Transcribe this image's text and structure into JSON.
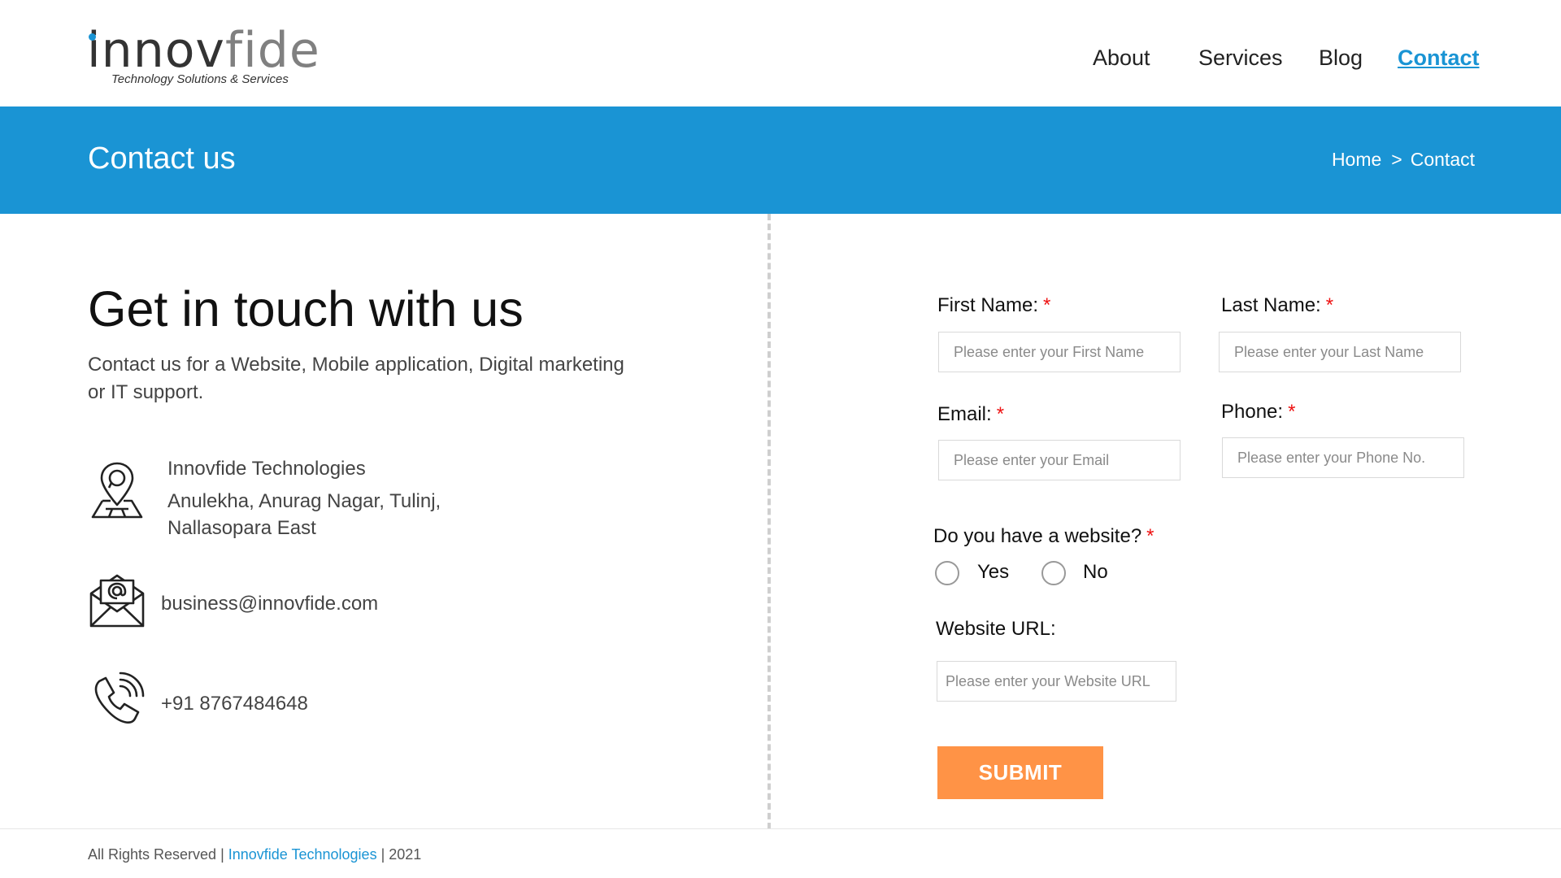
{
  "brand": {
    "logo_part1": "innov",
    "logo_part2": "fide",
    "tagline": "Technology Solutions & Services",
    "accent_color": "#1a94d4"
  },
  "nav": {
    "items": [
      {
        "label": "About"
      },
      {
        "label": "Services"
      },
      {
        "label": "Blog"
      },
      {
        "label": "Contact",
        "active": true
      }
    ]
  },
  "banner": {
    "title": "Contact us",
    "breadcrumb": {
      "home": "Home",
      "separator": ">",
      "current": "Contact"
    },
    "background": "#1a94d4"
  },
  "intro": {
    "heading": "Get in touch with us",
    "subtext": "Contact us for a Website, Mobile application, Digital marketing or IT support."
  },
  "contact_info": {
    "company": "Innovfide Technologies",
    "address_line1": "Anulekha, Anurag Nagar, Tulinj,",
    "address_line2": "Nallasopara East",
    "email": "business@innovfide.com",
    "phone": "+91 8767484648",
    "icons": [
      "location-pin-map-icon",
      "email-envelope-icon",
      "phone-call-icon"
    ]
  },
  "form": {
    "first_name": {
      "label": "First Name:",
      "required": "*",
      "placeholder": "Please enter your First Name"
    },
    "last_name": {
      "label": "Last Name:",
      "required": "*",
      "placeholder": "Please enter your Last Name"
    },
    "email": {
      "label": "Email:",
      "required": "*",
      "placeholder": "Please enter your Email"
    },
    "phone": {
      "label": "Phone:",
      "required": "*",
      "placeholder": "Please enter your Phone No."
    },
    "website_question": {
      "label": "Do you have a website?",
      "required": "*",
      "options": [
        "Yes",
        "No"
      ]
    },
    "website_url": {
      "label": "Website URL:",
      "placeholder": "Please enter your Website URL"
    },
    "submit_label": "SUBMIT",
    "submit_color": "#ff9346"
  },
  "footer": {
    "prefix": "All Rights Reserved |",
    "company": "Innovfide Technologies",
    "suffix": "| 2021"
  }
}
